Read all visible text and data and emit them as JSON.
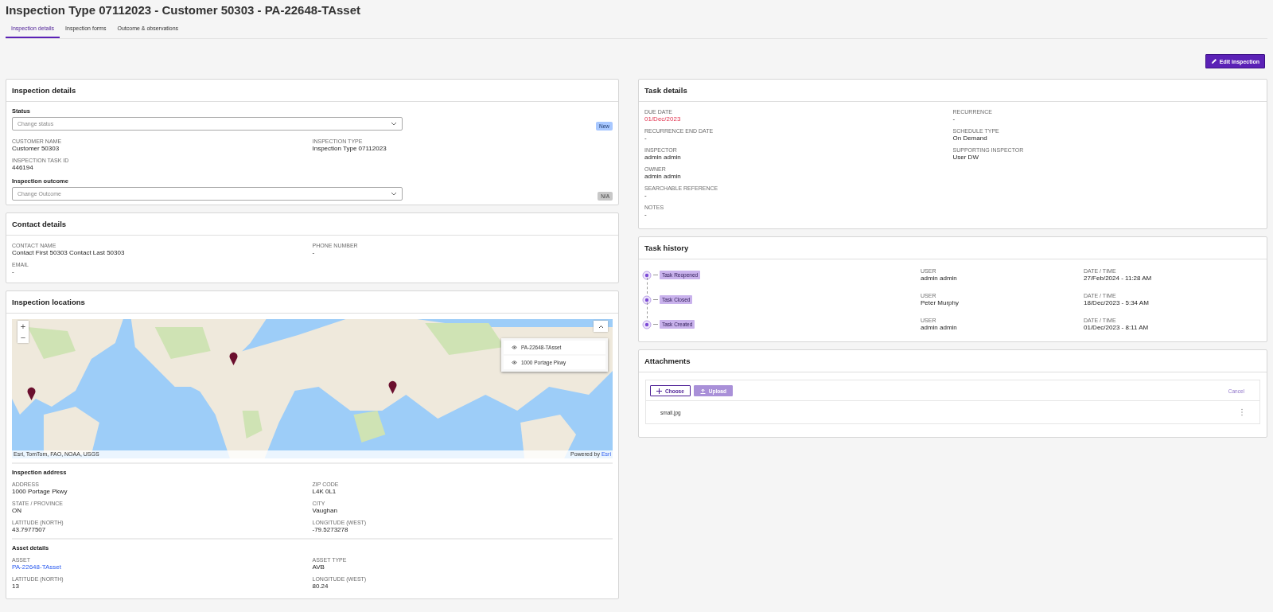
{
  "title": "Inspection Type 07112023 - Customer 50303 - PA-22648-TAsset",
  "tabs": [
    {
      "label": "Inspection details",
      "selected": true
    },
    {
      "label": "Inspection forms",
      "selected": false
    },
    {
      "label": "Outcome & observations",
      "selected": false
    }
  ],
  "edit_button": {
    "label": "Edit inspection"
  },
  "inspection_details": {
    "title": "Inspection details",
    "status": {
      "label": "Status",
      "placeholder": "Change status",
      "badge": "New"
    },
    "columns": [
      [
        {
          "label": "CUSTOMER NAME",
          "value": "Customer 50303"
        },
        {
          "label": "INSPECTION TASK ID",
          "value": "446194"
        }
      ],
      [
        {
          "label": "INSPECTION TYPE",
          "value": "Inspection Type 07112023"
        }
      ]
    ],
    "outcome": {
      "label": "Inspection outcome",
      "placeholder": "Change Outcome",
      "badge": "N/A"
    }
  },
  "contact_details": {
    "title": "Contact details",
    "columns": [
      [
        {
          "label": "CONTACT NAME",
          "value": "Contact First 50303 Contact Last 50303"
        },
        {
          "label": "EMAIL",
          "value": "-"
        }
      ],
      [
        {
          "label": "PHONE NUMBER",
          "value": "-"
        }
      ]
    ]
  },
  "inspection_locations": {
    "title": "Inspection locations",
    "map": {
      "kind": "picture",
      "zoom_in": "+",
      "zoom_out": "−",
      "legend": [
        "PA-22648-TAsset",
        "1000 Portage Pkwy"
      ],
      "attribution": "Esri, TomTom, FAO, NOAA, USGS",
      "powered_by": "Powered by",
      "powered_link": "Esri"
    },
    "sections": [
      {
        "title": "Inspection address",
        "columns": [
          [
            {
              "label": "ADDRESS",
              "value": "1000 Portage Pkwy"
            },
            {
              "label": "STATE / PROVINCE",
              "value": "ON"
            },
            {
              "label": "LATITUDE (NORTH)",
              "value": "43.7977507"
            }
          ],
          [
            {
              "label": "ZIP CODE",
              "value": "L4K 0L1"
            },
            {
              "label": "CITY",
              "value": "Vaughan"
            },
            {
              "label": "LONGITUDE (WEST)",
              "value": "-79.5273278"
            }
          ]
        ]
      },
      {
        "title": "Asset details",
        "columns": [
          [
            {
              "label": "ASSET",
              "value": "PA-22648-TAsset",
              "kind": "link"
            },
            {
              "label": "LATITUDE (NORTH)",
              "value": "13"
            }
          ],
          [
            {
              "label": "ASSET TYPE",
              "value": "AVB"
            },
            {
              "label": "LONGITUDE (WEST)",
              "value": "80.24"
            }
          ]
        ]
      }
    ]
  },
  "task_details": {
    "title": "Task details",
    "columns": [
      [
        {
          "label": "DUE DATE",
          "value": "01/Dec/2023",
          "overdue": true
        },
        {
          "label": "RECURRENCE END DATE",
          "value": "-"
        },
        {
          "label": "INSPECTOR",
          "value": "admin admin"
        },
        {
          "label": "OWNER",
          "value": "admin admin"
        },
        {
          "label": "SEARCHABLE REFERENCE",
          "value": "-"
        },
        {
          "label": "NOTES",
          "value": "-"
        }
      ],
      [
        {
          "label": "RECURRENCE",
          "value": "-"
        },
        {
          "label": "SCHEDULE TYPE",
          "value": "On Demand"
        },
        {
          "label": "SUPPORTING INSPECTOR",
          "value": "User DW"
        }
      ]
    ]
  },
  "task_history": {
    "title": "Task history",
    "events": [
      {
        "event": "Task Reopened",
        "user_label": "USER",
        "user": "admin admin",
        "date_label": "DATE / TIME",
        "date": "27/Feb/2024 - 11:28 AM"
      },
      {
        "event": "Task Closed",
        "user_label": "USER",
        "user": "Peter Murphy",
        "date_label": "DATE / TIME",
        "date": "18/Dec/2023 - 5:34 AM"
      },
      {
        "event": "Task Created",
        "user_label": "USER",
        "user": "admin admin",
        "date_label": "DATE / TIME",
        "date": "01/Dec/2023 - 8:11 AM"
      }
    ]
  },
  "attachments": {
    "title": "Attachments",
    "buttons": [
      {
        "kind": "choose",
        "label": "Choose",
        "disabled": false
      },
      {
        "kind": "upload",
        "label": "Upload",
        "disabled": true
      },
      {
        "kind": "cancel",
        "label": "Cancel",
        "disabled": true
      }
    ],
    "files": [
      "small.jpg"
    ]
  }
}
